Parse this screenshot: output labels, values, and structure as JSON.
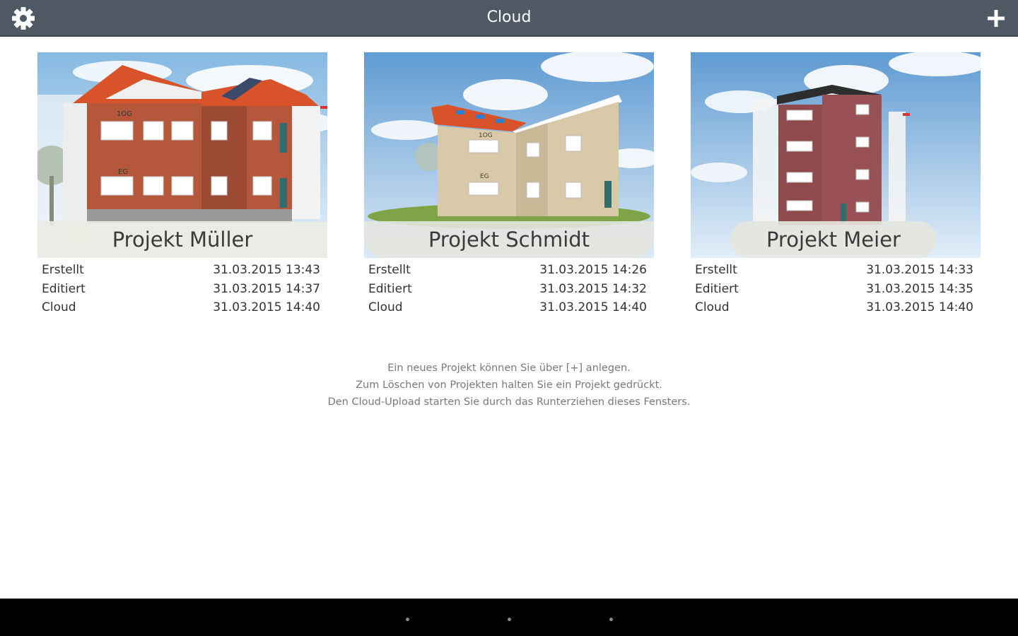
{
  "header": {
    "title": "Cloud",
    "settings_icon": "gear-icon",
    "add_icon": "plus-icon"
  },
  "projects": [
    {
      "name": "Projekt Müller",
      "rows": [
        {
          "label": "Erstellt",
          "value": "31.03.2015 13:43"
        },
        {
          "label": "Editiert",
          "value": "31.03.2015 14:37"
        },
        {
          "label": "Cloud",
          "value": "31.03.2015 14:40"
        }
      ]
    },
    {
      "name": "Projekt Schmidt",
      "rows": [
        {
          "label": "Erstellt",
          "value": "31.03.2015 14:26"
        },
        {
          "label": "Editiert",
          "value": "31.03.2015 14:32"
        },
        {
          "label": "Cloud",
          "value": "31.03.2015 14:40"
        }
      ]
    },
    {
      "name": "Projekt Meier",
      "rows": [
        {
          "label": "Erstellt",
          "value": "31.03.2015 14:33"
        },
        {
          "label": "Editiert",
          "value": "31.03.2015 14:35"
        },
        {
          "label": "Cloud",
          "value": "31.03.2015 14:40"
        }
      ]
    }
  ],
  "hints": [
    "Ein neues Projekt können Sie über [+] anlegen.",
    "Zum Löschen von Projekten halten Sie ein Projekt gedrückt.",
    "Den Cloud-Upload starten Sie durch das Runterziehen dieses Fensters."
  ],
  "thumbnail_labels": {
    "p1_floor_top": "1OG",
    "p1_floor_mid": "EG",
    "p2_floor_top": "1OG",
    "p2_floor_mid": "EG"
  },
  "colors": {
    "topbar": "#4f5963",
    "roof": "#d9532a",
    "brick_red": "#b5573a",
    "brick_beige": "#d8c9a8",
    "brick_dark": "#8e4a4d",
    "sky": "#9cc6e8",
    "navbar": "#000000"
  }
}
